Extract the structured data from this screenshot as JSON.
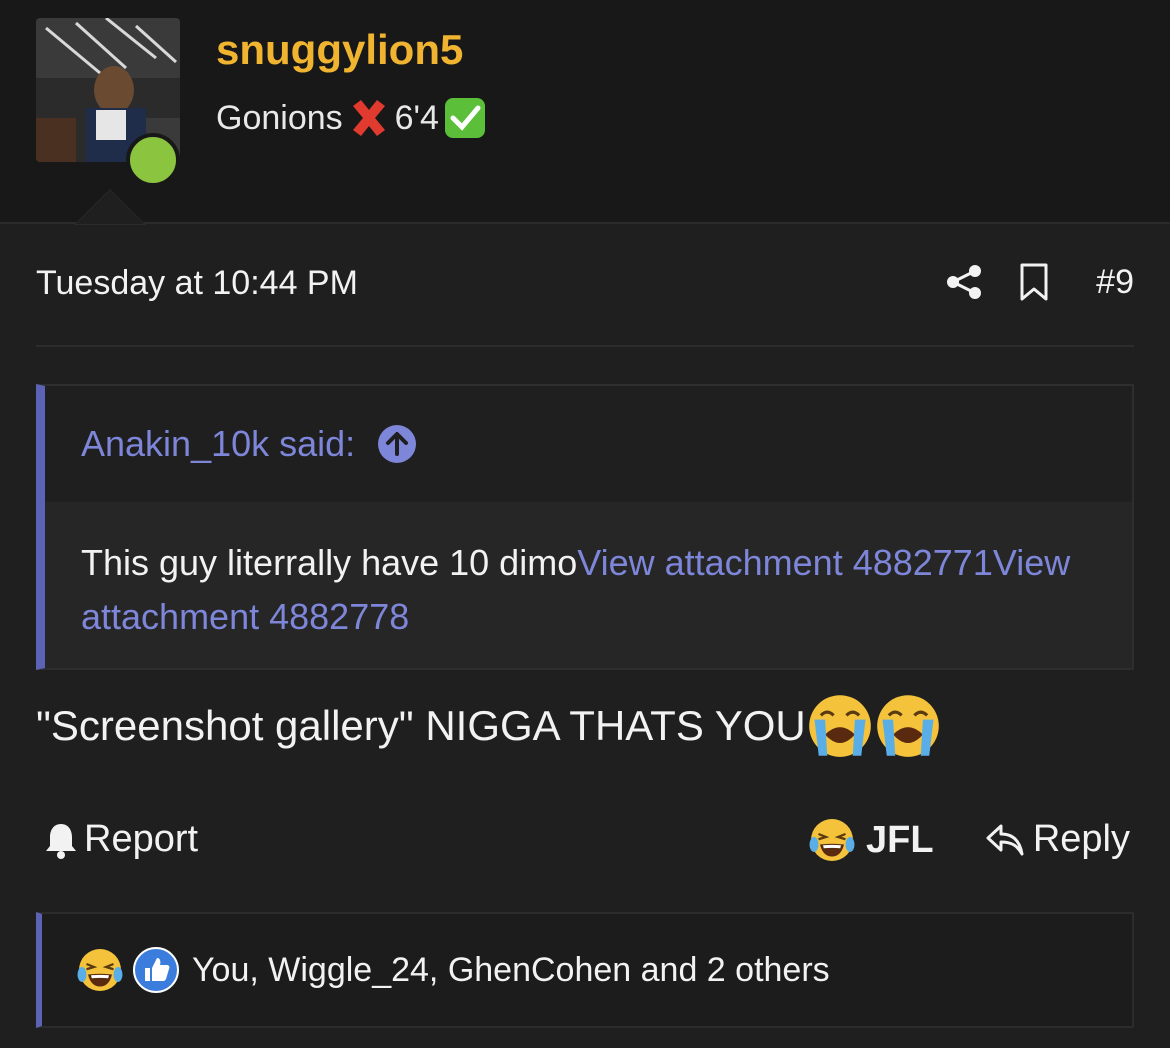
{
  "user": {
    "username": "snuggylion5",
    "title_part1": "Gonions",
    "title_part2": "6'4",
    "title_icons": [
      "red-cross-icon",
      "green-check-icon"
    ],
    "online": true,
    "online_color": "#8bc43f",
    "username_color": "#f0b430"
  },
  "post": {
    "time": "Tuesday at 10:44 PM",
    "number": "#9",
    "actions": [
      "share-icon",
      "bookmark-icon"
    ]
  },
  "quote": {
    "author": "Anakin_10k said:",
    "text": "This guy literrally have 10 dimo",
    "link1": "View attachment 4882771",
    "link2": "View attachment 4882778",
    "accent": "#5c63b4"
  },
  "body": {
    "text": "\"Screenshot gallery\" NIGGA THATS YOU",
    "emojis": [
      "crying-face-icon",
      "crying-face-icon"
    ]
  },
  "footer": {
    "report": "Report",
    "reaction": "JFL",
    "reply": "Reply"
  },
  "reactions": {
    "icons": [
      "laughing-face-icon",
      "like-icon"
    ],
    "text": "You, Wiggle_24, GhenCohen and 2 others"
  }
}
